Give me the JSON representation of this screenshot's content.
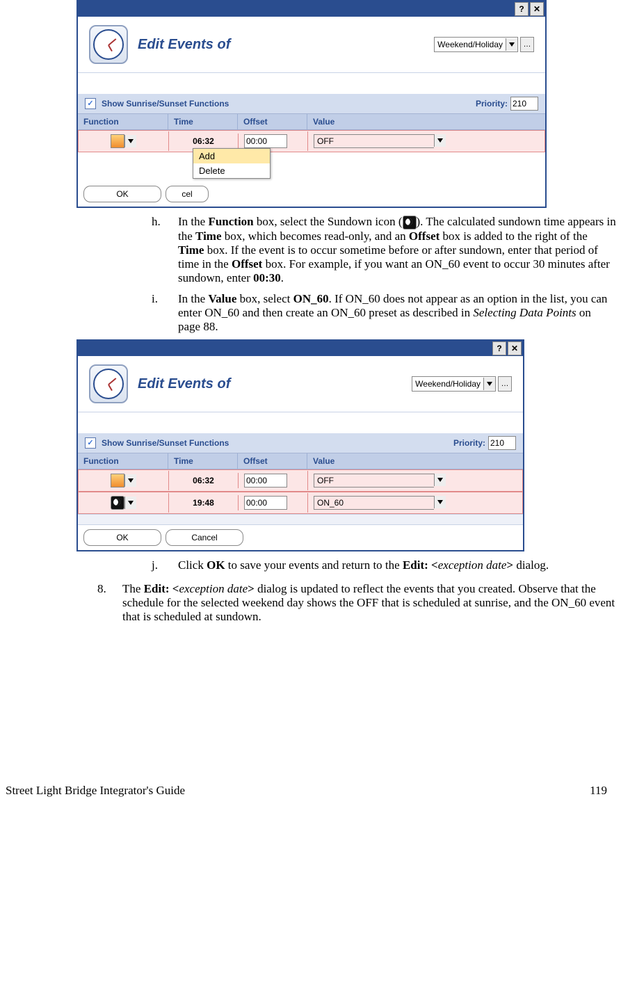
{
  "dialog": {
    "title": "Edit Events of",
    "selector": {
      "value": "Weekend/Holiday"
    },
    "show_sun_label": "Show Sunrise/Sunset Functions",
    "priority_label": "Priority:",
    "priority_value": "210",
    "cols": {
      "func": "Function",
      "time": "Time",
      "offset": "Offset",
      "value": "Value"
    },
    "context_menu": {
      "add": "Add",
      "delete": "Delete"
    },
    "buttons": {
      "ok": "OK",
      "cancel": "Cancel",
      "cancel_trunc": "cel"
    }
  },
  "dlg1_rows": [
    {
      "time": "06:32",
      "offset": "00:00",
      "value": "OFF",
      "icon": "sunrise"
    }
  ],
  "dlg2_rows": [
    {
      "time": "06:32",
      "offset": "00:00",
      "value": "OFF",
      "icon": "sunrise"
    },
    {
      "time": "19:48",
      "offset": "00:00",
      "value": "ON_60",
      "icon": "sundown"
    }
  ],
  "steps": {
    "h": {
      "label": "h.",
      "t1": "In the ",
      "b1": "Function",
      "t2": " box, select the Sundown icon (",
      "t3": "). The calculated sundown time appears in the ",
      "b2": "Time",
      "t4": " box, which becomes read-only, and an ",
      "b3": "Offset",
      "t5": " box is added to the right of the ",
      "b4": "Time",
      "t6": " box.  If the event is to occur sometime before or after sundown, enter that period of time in the ",
      "b5": "Offset",
      "t7": " box.  For example, if you want an ON_60 event to occur 30 minutes after sundown, enter ",
      "b6": "00:30",
      "t8": "."
    },
    "i": {
      "label": "i.",
      "t1": "In the ",
      "b1": "Value",
      "t2": " box, select ",
      "b2": "ON_60",
      "t3": ".  If ON_60 does not appear as an option in the list, you can enter ON_60 and then create an ON_60 preset as described in ",
      "i1": "Selecting Data Points",
      "t4": " on page 88."
    },
    "j": {
      "label": "j.",
      "t1": "Click ",
      "b1": "OK",
      "t2": " to save your events and return to the ",
      "b2": "Edit: <",
      "i1": "exception date",
      "b3": ">",
      "t3": " dialog."
    },
    "s8": {
      "label": "8.",
      "t1": "The ",
      "b1": "Edit: <",
      "i1": "exception date",
      "b2": ">",
      "t2": " dialog is updated to reflect the events that you created.  Observe that the schedule for the selected weekend day shows the OFF that is scheduled at sunrise, and the ON_60 event that is scheduled at sundown."
    }
  },
  "footer": {
    "left": "Street Light Bridge Integrator's Guide",
    "right": "119"
  }
}
